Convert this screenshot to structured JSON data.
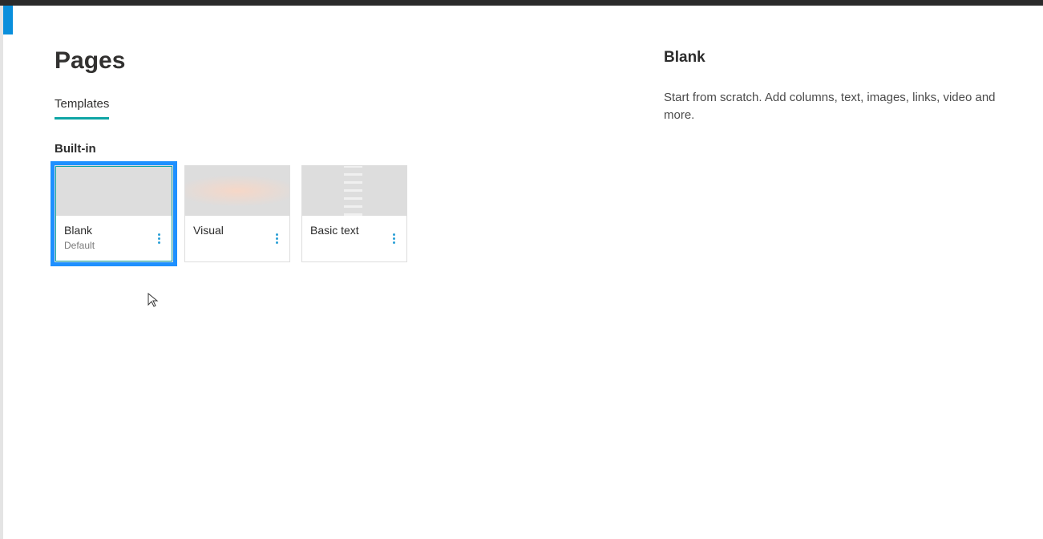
{
  "header": {
    "title": "Pages"
  },
  "tabs": {
    "items": [
      {
        "label": "Templates",
        "active": true
      }
    ]
  },
  "section": {
    "label": "Built-in"
  },
  "templates": [
    {
      "title": "Blank",
      "subtitle": "Default",
      "thumb": "blank",
      "selected": true
    },
    {
      "title": "Visual",
      "subtitle": "",
      "thumb": "visual",
      "selected": false
    },
    {
      "title": "Basic text",
      "subtitle": "",
      "thumb": "beach",
      "selected": false
    }
  ],
  "details": {
    "title": "Blank",
    "description": "Start from scratch. Add columns, text, images, links, video and more."
  }
}
